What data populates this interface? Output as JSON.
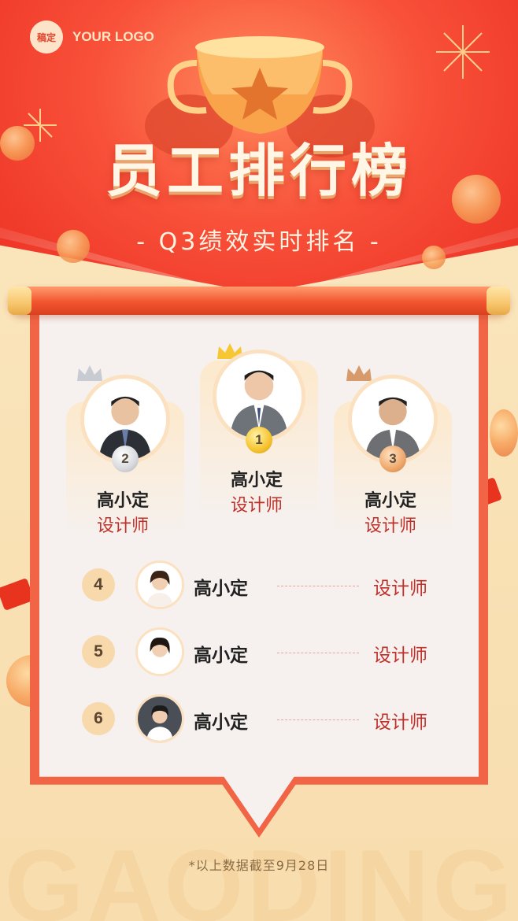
{
  "logo": {
    "badge": "稿定",
    "text": "YOUR LOGO"
  },
  "title": "员工排行榜",
  "subtitle": "- Q3绩效实时排名 -",
  "top3": [
    {
      "rank": "1",
      "name": "高小定",
      "role": "设计师"
    },
    {
      "rank": "2",
      "name": "高小定",
      "role": "设计师"
    },
    {
      "rank": "3",
      "name": "高小定",
      "role": "设计师"
    }
  ],
  "list": [
    {
      "rank": "4",
      "name": "高小定",
      "role": "设计师"
    },
    {
      "rank": "5",
      "name": "高小定",
      "role": "设计师"
    },
    {
      "rank": "6",
      "name": "高小定",
      "role": "设计师"
    }
  ],
  "footnote": "*以上数据截至9月28日",
  "watermark": "GAODING",
  "colors": {
    "accent_red": "#f0452e",
    "gold": "#f7c66c",
    "role_red": "#c0302a"
  },
  "icons": [
    "trophy-icon",
    "crown-icon",
    "medal-icon",
    "coin-icon",
    "red-envelope-icon",
    "firework-icon"
  ]
}
